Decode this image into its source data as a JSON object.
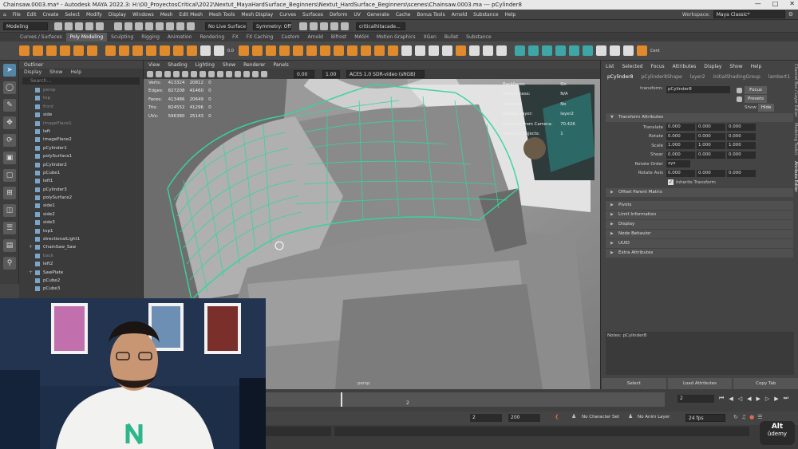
{
  "window": {
    "title": "Chainsaw.0003.ma* - Autodesk MAYA 2022.3: H:\\00_ProyectosCritical\\2022\\Nextut_MayaHardSurface_Beginners\\Nextut_HardSurface_Beginners\\scenes\\Chainsaw.0003.ma --- pCylinder8",
    "controls": [
      "—",
      "□",
      "✕"
    ]
  },
  "menubar": {
    "items": [
      "File",
      "Edit",
      "Create",
      "Select",
      "Modify",
      "Display",
      "Windows",
      "Mesh",
      "Edit Mesh",
      "Mesh Tools",
      "Mesh Display",
      "Curves",
      "Surfaces",
      "Deform",
      "UV",
      "Generate",
      "Cache",
      "Bonus Tools",
      "Arnold",
      "Substance",
      "Help"
    ],
    "workspace_label": "Workspace:",
    "workspace_value": "Maya Classic*"
  },
  "statusline": {
    "mode": "Modeling",
    "live_surface": "No Live Surface",
    "symmetry": "Symmetry: Off",
    "selection_set": "criticalhitacade..."
  },
  "shelf": {
    "tabs": [
      "Curves / Surfaces",
      "Poly Modeling",
      "Sculpting",
      "Rigging",
      "Animation",
      "Rendering",
      "FX",
      "FX Caching",
      "Custom",
      "Arnold",
      "Bifrost",
      "MASH",
      "Motion Graphics",
      "XGen",
      "Bullet",
      "Substance"
    ],
    "active_tab": "Poly Modeling",
    "tool_text": [
      "0.0",
      "Cent"
    ]
  },
  "outliner": {
    "title": "Outliner",
    "menu": [
      "Display",
      "Show",
      "Help"
    ],
    "search_placeholder": "Search...",
    "items": [
      {
        "label": "persp",
        "dim": true
      },
      {
        "label": "top",
        "dim": true
      },
      {
        "label": "front",
        "dim": true
      },
      {
        "label": "side",
        "dim": false
      },
      {
        "label": "imagePlane1",
        "dim": true
      },
      {
        "label": "left",
        "dim": false
      },
      {
        "label": "imagePlane2",
        "dim": false
      },
      {
        "label": "pCylinder1",
        "dim": false
      },
      {
        "label": "polySurface1",
        "dim": false
      },
      {
        "label": "pCylinder2",
        "dim": false
      },
      {
        "label": "pCube1",
        "dim": false
      },
      {
        "label": "left1",
        "dim": false
      },
      {
        "label": "pCylinder3",
        "dim": false
      },
      {
        "label": "polySurface2",
        "dim": false
      },
      {
        "label": "side1",
        "dim": false
      },
      {
        "label": "side2",
        "dim": false
      },
      {
        "label": "side3",
        "dim": false
      },
      {
        "label": "top1",
        "dim": false
      },
      {
        "label": "directionalLight1",
        "dim": false
      },
      {
        "label": "ChainSaw_Saw",
        "dim": false,
        "expand": true
      },
      {
        "label": "back",
        "dim": true
      },
      {
        "label": "left2",
        "dim": false
      },
      {
        "label": "SawPlate",
        "dim": false,
        "expand": true
      },
      {
        "label": "pCube2",
        "dim": false
      },
      {
        "label": "pCube3",
        "dim": false
      }
    ]
  },
  "viewport": {
    "menu": [
      "View",
      "Shading",
      "Lighting",
      "Show",
      "Renderer",
      "Panels"
    ],
    "exposure": "0.00",
    "gamma": "1.00",
    "color_space": "ACES 1.0 SDR-video (sRGB)",
    "camera": "persp",
    "hud_stats": [
      {
        "label": "Verts:",
        "a": "413324",
        "b": "20812",
        "c": "0"
      },
      {
        "label": "Edges:",
        "a": "827208",
        "b": "41460",
        "c": "0"
      },
      {
        "label": "Faces:",
        "a": "413486",
        "b": "20649",
        "c": "0"
      },
      {
        "label": "Tris:",
        "a": "824552",
        "b": "41296",
        "c": "0"
      },
      {
        "label": "UVs:",
        "a": "596380",
        "b": "25143",
        "c": "0"
      }
    ],
    "hud_info": [
      {
        "label": "Backfaces:",
        "value": "On"
      },
      {
        "label": "Smoothness:",
        "value": "N/A"
      },
      {
        "label": "Instance:",
        "value": "No"
      },
      {
        "label": "Display Layer:",
        "value": "layer2"
      },
      {
        "label": "Distance From Camera:",
        "value": "70.426"
      },
      {
        "label": "Selected Objects:",
        "value": "1"
      }
    ]
  },
  "attribute_editor": {
    "menu": [
      "List",
      "Selected",
      "Focus",
      "Attributes",
      "Display",
      "Show",
      "Help"
    ],
    "tabs": [
      "pCylinder8",
      "pCylinder8Shape",
      "layer2",
      "initialShadingGroup",
      "lambert1"
    ],
    "transform_label": "transform:",
    "transform_value": "pCylinder8",
    "focus": "Focus",
    "presets": "Presets",
    "show": "Show",
    "hide": "Hide",
    "transform_section": "Transform Attributes",
    "translate": {
      "label": "Translate",
      "values": [
        "0.000",
        "0.000",
        "0.000"
      ]
    },
    "rotate": {
      "label": "Rotate",
      "values": [
        "0.000",
        "0.000",
        "0.000"
      ]
    },
    "scale": {
      "label": "Scale",
      "values": [
        "1.000",
        "1.000",
        "1.000"
      ]
    },
    "shear": {
      "label": "Shear",
      "values": [
        "0.000",
        "0.000",
        "0.000"
      ]
    },
    "rotate_order": {
      "label": "Rotate Order",
      "value": "xyz"
    },
    "rotate_axis": {
      "label": "Rotate Axis",
      "values": [
        "0.000",
        "0.000",
        "0.000"
      ]
    },
    "inherits_transform": "Inherits Transform",
    "sections": [
      "Offset Parent Matrix",
      "Pivots",
      "Limit Information",
      "Display",
      "Node Behavior",
      "UUID",
      "Extra Attributes"
    ],
    "notes_label": "Notes: pCylinder8",
    "bottom_buttons": [
      "Select",
      "Load Attributes",
      "Copy Tab"
    ]
  },
  "side_tabs": [
    "Channel Box / Layer Editor",
    "Modeling Toolkit",
    "Attribute Editor"
  ],
  "timeline": {
    "ticks": [
      "2"
    ],
    "current_frame": "2"
  },
  "range": {
    "start": "2",
    "end": "200",
    "character_set": "No Character Set",
    "anim_layer": "No Anim Layer",
    "fps": "24 fps"
  },
  "watermark": {
    "line1": "Alt",
    "line2": "ûdemy"
  }
}
